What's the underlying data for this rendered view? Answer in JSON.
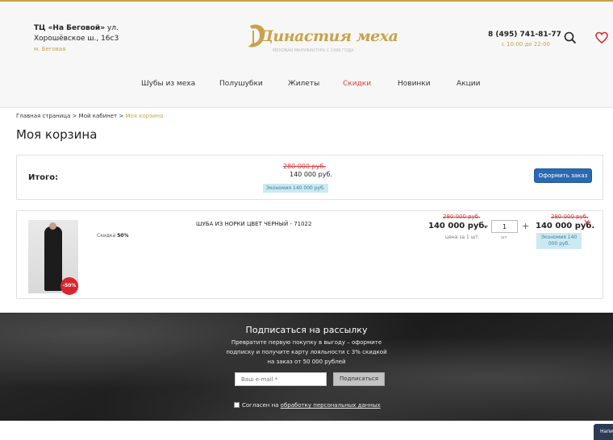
{
  "header": {
    "address_bold": "ТЦ «На Беговой»",
    "address_rest": " ул. Хорошёвское ш., 16с3",
    "metro": "м. Беговая",
    "logo_text": "Династия меха",
    "logo_subtitle": "МЕХОВАЯ МАНУФАКТУРА С 1996 ГОДА",
    "phone": "8 (495) 741-81-77",
    "hours": "с 10:00 до 22:00",
    "search_icon": "search-icon",
    "favorites_icon": "heart-icon"
  },
  "nav": {
    "items": [
      {
        "label": "Шубы из меха"
      },
      {
        "label": "Полушубки"
      },
      {
        "label": "Жилеты"
      },
      {
        "label": "Скидки"
      },
      {
        "label": "Новинки"
      },
      {
        "label": "Акции"
      }
    ],
    "active_color": "#d84040"
  },
  "breadcrumbs": {
    "home": "Главная страница",
    "cabinet": "Мой кабинет",
    "current": "Моя корзина",
    "separator": ">"
  },
  "page_title": "Моя корзина",
  "total": {
    "label": "Итого:",
    "old_price": "280 000 руб.",
    "new_price": "140 000 руб.",
    "economy": "Экономия 140 000 руб.",
    "order_button": "Оформить заказ"
  },
  "item": {
    "discount_badge": "-50%",
    "discount_label": "Скидка",
    "discount_value": "50%",
    "name": "ШУБА ИЗ НОРКИ ЦВЕТ ЧЕРНЫЙ - 71022",
    "old_price": "280 000 руб.",
    "price": "140 000 руб.",
    "price_unit": "цена за 1 шт",
    "quantity": "1",
    "quantity_unit": "шт",
    "minus": "−",
    "plus": "+",
    "sum_old": "280 000 руб.",
    "sum_new": "140 000 руб.",
    "sum_economy": "Экономия 140 000 руб.",
    "remove": "✕"
  },
  "footer": {
    "title": "Подписаться на рассылку",
    "text": "Превратите первую покупку в выгоду – оформите подписку и получите карту лояльности с 3% скидкой на заказ от 50 000 рублей",
    "email_placeholder": "Ваш e-mail *",
    "subscribe_button": "Подписаться",
    "agree_text": "Согласен на ",
    "agree_link": "обработку персональных данных"
  },
  "chat_tab": "Напи",
  "colors": {
    "accent": "#c9a24a",
    "primary_button": "#2a6ab3",
    "sale": "#d84040"
  }
}
